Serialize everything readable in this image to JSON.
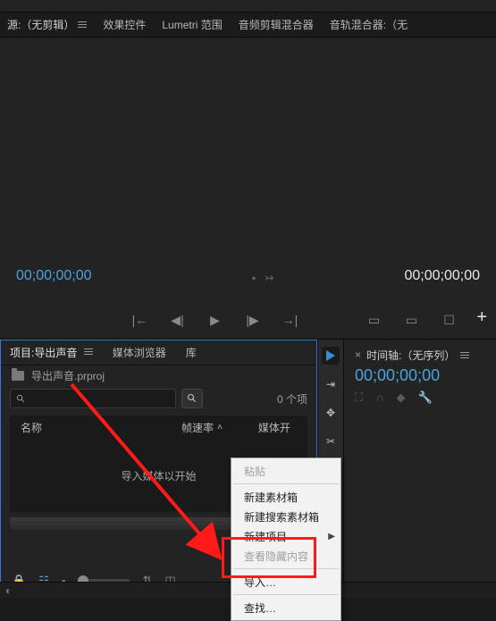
{
  "tabs": {
    "source": "源:（无剪辑）",
    "effect_controls": "效果控件",
    "lumetri": "Lumetri 范围",
    "audio_clip_mixer": "音频剪辑混合器",
    "audio_track_mixer": "音轨混合器:（无"
  },
  "timecode": {
    "in": "00;00;00;00",
    "out": "00;00;00;00"
  },
  "project": {
    "tabs": {
      "project": "项目:导出声音",
      "media_browser": "媒体浏览器",
      "library": "库"
    },
    "filename": "导出声音.prproj",
    "item_count": "0 个项",
    "columns": {
      "name": "名称",
      "fps": "帧速率",
      "start": "媒体开"
    },
    "empty_hint": "导入媒体以开始"
  },
  "timeline": {
    "tab_label": "时间轴:（无序列）",
    "tc": "00;00;00;00",
    "tab_close": "×"
  },
  "context_menu": {
    "paste": "粘贴",
    "new_bin": "新建素材箱",
    "new_search_bin": "新建搜索素材箱",
    "new_item": "新建项目",
    "hidden_item": "查看隐藏内容",
    "import": "导入…",
    "find": "查找…"
  },
  "plus": "+",
  "status_icon": "◐"
}
